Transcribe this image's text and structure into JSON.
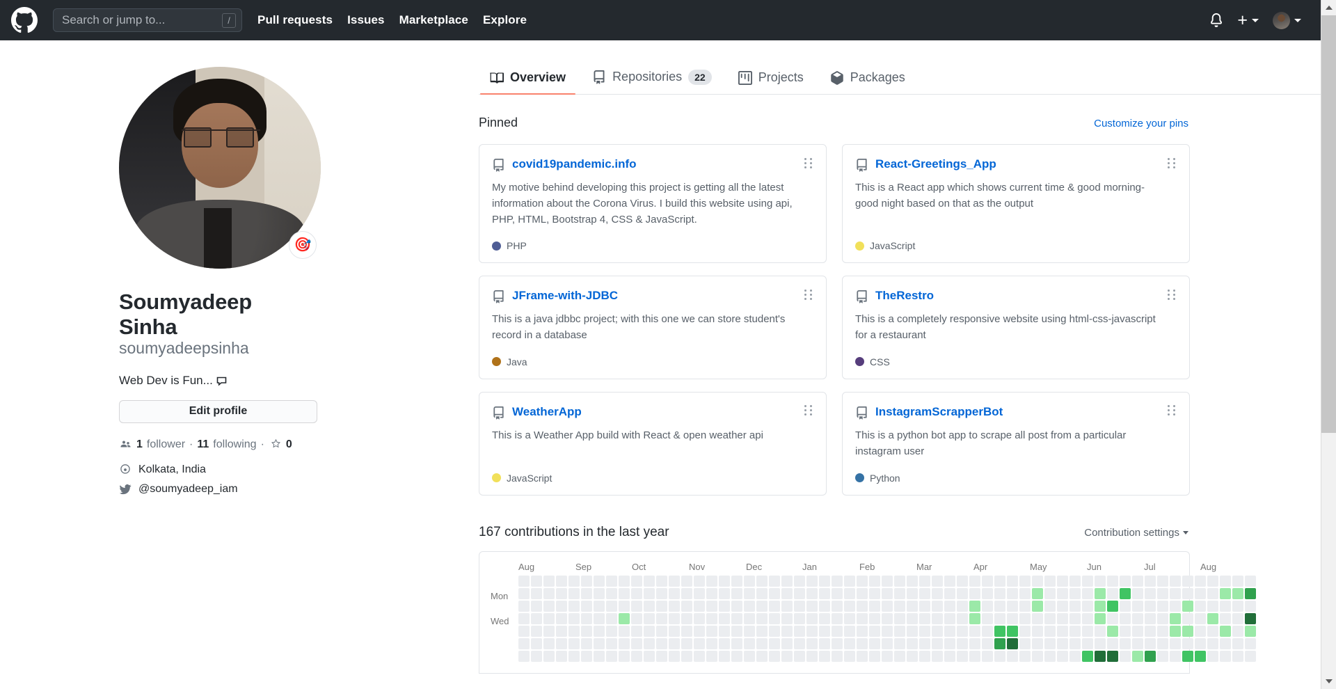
{
  "header": {
    "logo_icon": "github-mark-icon",
    "search": {
      "placeholder": "Search or jump to...",
      "value": "",
      "shortcut": "/"
    },
    "nav": [
      {
        "label": "Pull requests"
      },
      {
        "label": "Issues"
      },
      {
        "label": "Marketplace"
      },
      {
        "label": "Explore"
      }
    ],
    "notifications_icon": "bell-icon",
    "create_new_label": "+",
    "account_icon": "user-avatar-icon",
    "bg_color": "#24292e"
  },
  "profile": {
    "avatar_alt": "user-avatar-photo",
    "status_emoji": "🎯",
    "name": "Soumyadeep Sinha",
    "login": "soumyadeepsinha",
    "status_text": "Web Dev is Fun...",
    "edit_button": "Edit profile",
    "followers_count": "1",
    "followers_label": "follower",
    "following_count": "11",
    "following_label": "following",
    "stars_count": "0",
    "separator": "·",
    "location": "Kolkata, India",
    "twitter": "@soumyadeep_iam"
  },
  "tabs": [
    {
      "label": "Overview",
      "icon": "book-icon",
      "active": true,
      "count": ""
    },
    {
      "label": "Repositories",
      "icon": "repo-icon",
      "active": false,
      "count": "22"
    },
    {
      "label": "Projects",
      "icon": "project-board-icon",
      "active": false,
      "count": ""
    },
    {
      "label": "Packages",
      "icon": "package-cube-icon",
      "active": false,
      "count": ""
    }
  ],
  "pinned": {
    "title": "Pinned",
    "customize_link": "Customize your pins",
    "repos": [
      {
        "name": "covid19pandemic.info",
        "description": "My motive behind developing this project is getting all the latest information about the Corona Virus. I build this website using api, PHP, HTML, Bootstrap 4, CSS & JavaScript.",
        "language": "PHP",
        "language_color": "#4F5D95"
      },
      {
        "name": "React-Greetings_App",
        "description": "This is a React app which shows current time & good morning- good night based on that as the output",
        "language": "JavaScript",
        "language_color": "#f1e05a"
      },
      {
        "name": "JFrame-with-JDBC",
        "description": "This is a java jdbbc project; with this one we can store student's record in a database",
        "language": "Java",
        "language_color": "#b07219"
      },
      {
        "name": "TheRestro",
        "description": "This is a completely responsive website using html-css-javascript for a restaurant",
        "language": "CSS",
        "language_color": "#563d7c"
      },
      {
        "name": "WeatherApp",
        "description": "This is a Weather App build with React & open weather api",
        "language": "JavaScript",
        "language_color": "#f1e05a"
      },
      {
        "name": "InstagramScrapperBot",
        "description": "This is a python bot app to scrape all post from a particular instagram user",
        "language": "Python",
        "language_color": "#3572A5"
      }
    ]
  },
  "contributions": {
    "title": "167 contributions in the last year",
    "total": 167,
    "settings_label": "Contribution settings",
    "months": [
      "Aug",
      "Sep",
      "Oct",
      "Nov",
      "Dec",
      "Jan",
      "Feb",
      "Mar",
      "Apr",
      "May",
      "Jun",
      "Jul",
      "Aug"
    ],
    "day_labels": [
      "",
      "Mon",
      "",
      "Wed",
      "",
      "",
      ""
    ],
    "level_colors": [
      "#ebedf0",
      "#9be9a8",
      "#40c463",
      "#30a14e",
      "#216e39"
    ],
    "weeks": [
      [
        0,
        0,
        0,
        0,
        0,
        0,
        0
      ],
      [
        0,
        0,
        0,
        0,
        0,
        0,
        0
      ],
      [
        0,
        0,
        0,
        0,
        0,
        0,
        0
      ],
      [
        0,
        0,
        0,
        0,
        0,
        0,
        0
      ],
      [
        0,
        0,
        0,
        0,
        0,
        0,
        0
      ],
      [
        0,
        0,
        0,
        0,
        0,
        0,
        0
      ],
      [
        0,
        0,
        0,
        0,
        0,
        0,
        0
      ],
      [
        0,
        0,
        0,
        0,
        0,
        0,
        0
      ],
      [
        0,
        0,
        0,
        1,
        0,
        0,
        0
      ],
      [
        0,
        0,
        0,
        0,
        0,
        0,
        0
      ],
      [
        0,
        0,
        0,
        0,
        0,
        0,
        0
      ],
      [
        0,
        0,
        0,
        0,
        0,
        0,
        0
      ],
      [
        0,
        0,
        0,
        0,
        0,
        0,
        0
      ],
      [
        0,
        0,
        0,
        0,
        0,
        0,
        0
      ],
      [
        0,
        0,
        0,
        0,
        0,
        0,
        0
      ],
      [
        0,
        0,
        0,
        0,
        0,
        0,
        0
      ],
      [
        0,
        0,
        0,
        0,
        0,
        0,
        0
      ],
      [
        0,
        0,
        0,
        0,
        0,
        0,
        0
      ],
      [
        0,
        0,
        0,
        0,
        0,
        0,
        0
      ],
      [
        0,
        0,
        0,
        0,
        0,
        0,
        0
      ],
      [
        0,
        0,
        0,
        0,
        0,
        0,
        0
      ],
      [
        0,
        0,
        0,
        0,
        0,
        0,
        0
      ],
      [
        0,
        0,
        0,
        0,
        0,
        0,
        0
      ],
      [
        0,
        0,
        0,
        0,
        0,
        0,
        0
      ],
      [
        0,
        0,
        0,
        0,
        0,
        0,
        0
      ],
      [
        0,
        0,
        0,
        0,
        0,
        0,
        0
      ],
      [
        0,
        0,
        0,
        0,
        0,
        0,
        0
      ],
      [
        0,
        0,
        0,
        0,
        0,
        0,
        0
      ],
      [
        0,
        0,
        0,
        0,
        0,
        0,
        0
      ],
      [
        0,
        0,
        0,
        0,
        0,
        0,
        0
      ],
      [
        0,
        0,
        0,
        0,
        0,
        0,
        0
      ],
      [
        0,
        0,
        0,
        0,
        0,
        0,
        0
      ],
      [
        0,
        0,
        0,
        0,
        0,
        0,
        0
      ],
      [
        0,
        0,
        0,
        0,
        0,
        0,
        0
      ],
      [
        0,
        0,
        0,
        0,
        0,
        0,
        0
      ],
      [
        0,
        0,
        0,
        0,
        0,
        0,
        0
      ],
      [
        0,
        0,
        1,
        1,
        0,
        0,
        0
      ],
      [
        0,
        0,
        0,
        0,
        0,
        0,
        0
      ],
      [
        0,
        0,
        0,
        0,
        2,
        3,
        0
      ],
      [
        0,
        0,
        0,
        0,
        2,
        4,
        0
      ],
      [
        0,
        0,
        0,
        0,
        0,
        0,
        0
      ],
      [
        0,
        1,
        1,
        0,
        0,
        0,
        0
      ],
      [
        0,
        0,
        0,
        0,
        0,
        0,
        0
      ],
      [
        0,
        0,
        0,
        0,
        0,
        0,
        0
      ],
      [
        0,
        0,
        0,
        0,
        0,
        0,
        0
      ],
      [
        0,
        0,
        0,
        0,
        0,
        0,
        2
      ],
      [
        0,
        1,
        1,
        1,
        0,
        0,
        4
      ],
      [
        0,
        0,
        2,
        0,
        1,
        0,
        4
      ],
      [
        0,
        2,
        0,
        0,
        0,
        0,
        0
      ],
      [
        0,
        0,
        0,
        0,
        0,
        0,
        1
      ],
      [
        0,
        0,
        0,
        0,
        0,
        0,
        3
      ],
      [
        0,
        0,
        0,
        0,
        0,
        0,
        0
      ],
      [
        0,
        0,
        0,
        1,
        1,
        0,
        0
      ],
      [
        0,
        0,
        1,
        0,
        1,
        0,
        2
      ],
      [
        0,
        0,
        0,
        0,
        0,
        0,
        2
      ],
      [
        0,
        0,
        0,
        1,
        0,
        0,
        0
      ],
      [
        0,
        1,
        0,
        0,
        1,
        0,
        0
      ],
      [
        0,
        1,
        0,
        0,
        0,
        0,
        0
      ],
      [
        0,
        3,
        0,
        4,
        1,
        0,
        0
      ]
    ]
  },
  "scrollbar": {
    "up_icon": "chevron-up-icon",
    "down_icon": "chevron-down-icon"
  }
}
